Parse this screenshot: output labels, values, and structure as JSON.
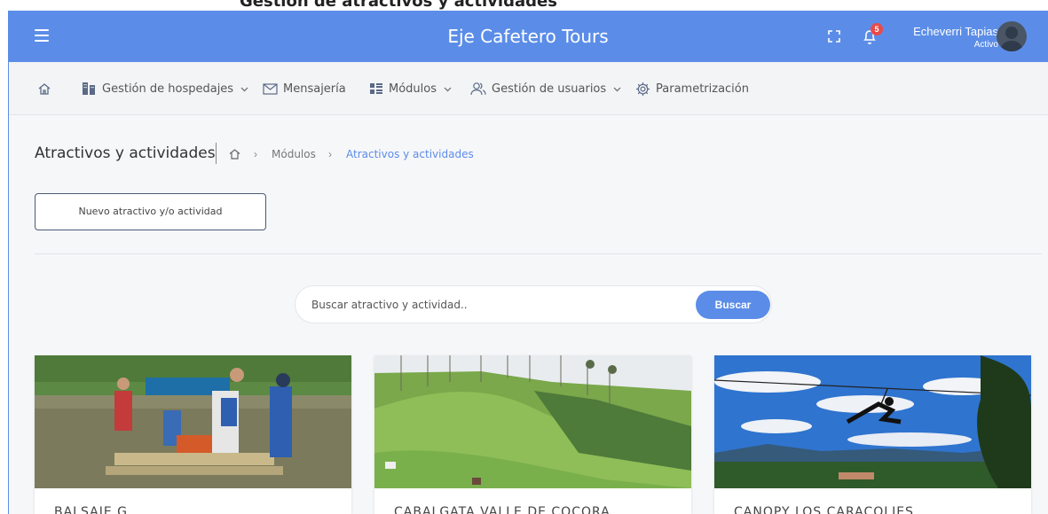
{
  "page_top_text": "Gestión de atractivos y actividades",
  "header": {
    "menu_icon": "hamburger-icon",
    "title": "Eje Cafetero Tours",
    "fullscreen_icon": "fullscreen-icon",
    "notifications_icon": "bell-icon",
    "notifications_count": "5",
    "user_name": "Echeverri Tapias",
    "user_status": "Activo",
    "avatar_icon": "user-avatar-icon",
    "color": "#5b8de8"
  },
  "nav": {
    "items": [
      {
        "label": "",
        "icon": "home-icon"
      },
      {
        "label": "Gestión de hospedajes",
        "icon": "building-icon",
        "has_dropdown": true
      },
      {
        "label": "Mensajería",
        "icon": "mail-icon"
      },
      {
        "label": "Módulos",
        "icon": "modules-icon",
        "has_dropdown": true
      },
      {
        "label": "Gestión de usuarios",
        "icon": "users-icon",
        "has_dropdown": true
      },
      {
        "label": "Parametrización",
        "icon": "gear-icon"
      }
    ]
  },
  "page": {
    "title": "Atractivos y actividades",
    "breadcrumb": [
      "Módulos",
      "Atractivos y actividades"
    ],
    "new_button": "Nuevo atractivo y/o actividad"
  },
  "search": {
    "placeholder": "Buscar atractivo y actividad..",
    "button": "Buscar"
  },
  "cards": [
    {
      "title": "BALSAJE G"
    },
    {
      "title": "CABALGATA VALLE DE COCORA"
    },
    {
      "title": "CANOPY LOS CARACOLIES"
    }
  ]
}
